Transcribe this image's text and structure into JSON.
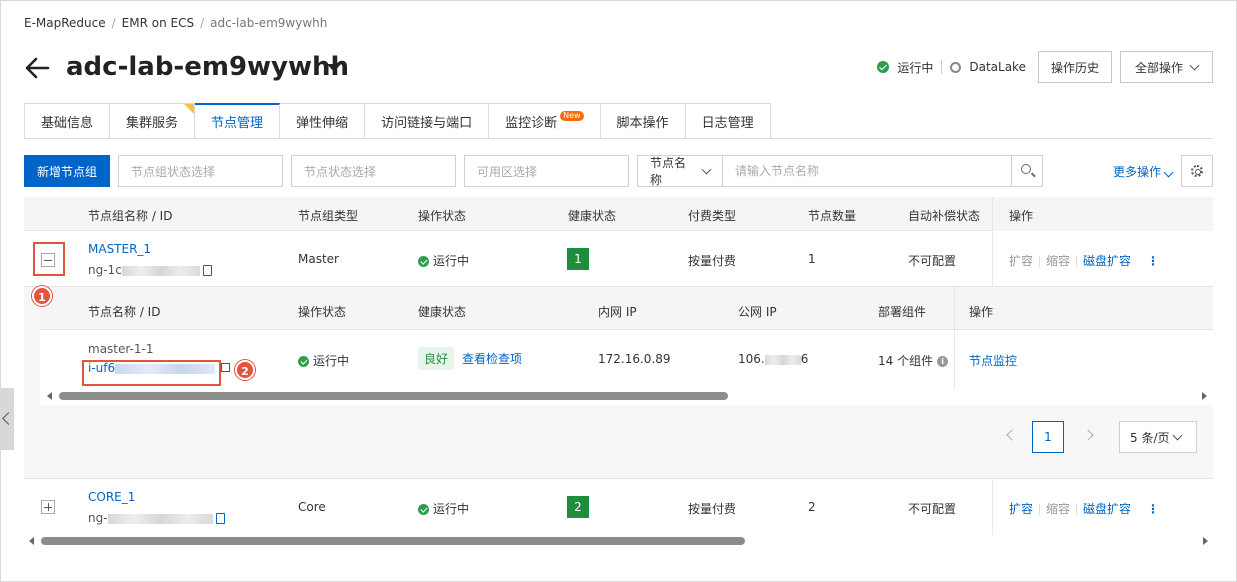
{
  "breadcrumb": [
    "E-MapReduce",
    "EMR on ECS",
    "adc-lab-em9wywhh"
  ],
  "header": {
    "title": "adc-lab-em9wywhh",
    "status": "运行中",
    "datalake": "DataLake",
    "history_btn": "操作历史",
    "all_ops_btn": "全部操作"
  },
  "tabs": [
    {
      "label": "基础信息"
    },
    {
      "label": "集群服务"
    },
    {
      "label": "节点管理"
    },
    {
      "label": "弹性伸缩"
    },
    {
      "label": "访问链接与端口"
    },
    {
      "label": "监控诊断",
      "badge": "New"
    },
    {
      "label": "脚本操作"
    },
    {
      "label": "日志管理"
    }
  ],
  "active_tab": "节点管理",
  "toolbar": {
    "add_group_btn": "新增节点组",
    "group_status_placeholder": "节点组状态选择",
    "node_status_placeholder": "节点状态选择",
    "zone_placeholder": "可用区选择",
    "name_select": "节点名称",
    "name_input_placeholder": "请输入节点名称",
    "more_ops": "更多操作"
  },
  "table": {
    "headers": [
      "节点组名称 / ID",
      "节点组类型",
      "操作状态",
      "健康状态",
      "付费类型",
      "节点数量",
      "自动补偿状态",
      "操作"
    ],
    "groups": [
      {
        "name": "MASTER_1",
        "id_prefix": "ng-1c",
        "type": "Master",
        "status": "运行中",
        "health": "1",
        "billing": "按量付费",
        "count": "1",
        "auto_comp": "不可配置",
        "ops": [
          "扩容",
          "缩容",
          "磁盘扩容"
        ]
      },
      {
        "name": "CORE_1",
        "id_prefix": "ng-",
        "type": "Core",
        "status": "运行中",
        "health": "2",
        "billing": "按量付费",
        "count": "2",
        "auto_comp": "不可配置",
        "ops": [
          "扩容",
          "缩容",
          "磁盘扩容"
        ]
      }
    ]
  },
  "inner_table": {
    "headers": [
      "节点名称 / ID",
      "操作状态",
      "健康状态",
      "内网 IP",
      "公网 IP",
      "部署组件",
      "操作"
    ],
    "row": {
      "name": "master-1-1",
      "id_prefix": "i-uf6",
      "status": "运行中",
      "health": "良好",
      "check_link": "查看检查项",
      "private_ip": "172.16.0.89",
      "public_ip_prefix": "106.",
      "public_ip_suffix": "6",
      "components": "14 个组件",
      "op": "节点监控"
    },
    "pagination": {
      "page": "1",
      "page_size": "5 条/页"
    }
  },
  "callouts": [
    "1",
    "2"
  ],
  "colors": {
    "primary": "#0064c8",
    "success": "#2e9d4e",
    "callout": "#e1553c",
    "new_badge": "#ff6a00"
  }
}
